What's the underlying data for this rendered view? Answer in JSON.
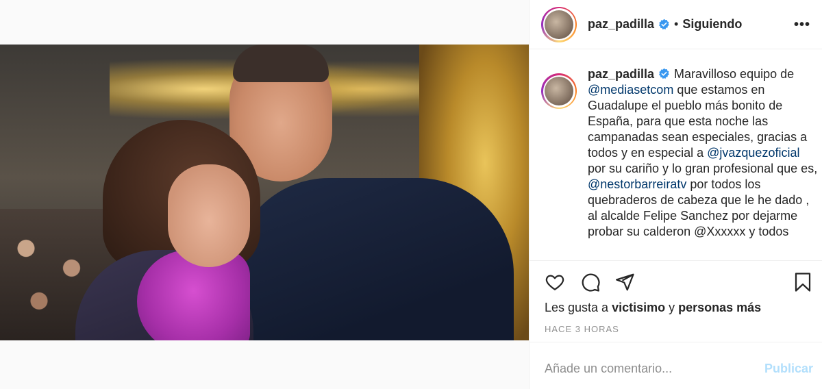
{
  "post": {
    "username": "paz_padilla",
    "follow_status": "Siguiendo",
    "dot": "•",
    "more_label": "•••"
  },
  "caption": {
    "username": "paz_padilla",
    "parts": [
      "Maravilloso equipo de ",
      "@mediasetcom",
      " que estamos en Guadalupe el pueblo más bonito de España, para que esta noche las campanadas sean especiales, gracias a todos y en especial a ",
      "@jvazquezoficial",
      " por su cariño y lo gran profesional que es, ",
      "@nestorbarreiratv",
      " por todos los quebraderos de cabeza que le he dado , al alcalde Felipe Sanchez por dejarme ",
      "probar su calderon @Xxxxxx y todos"
    ]
  },
  "likes": {
    "prefix": "Les gusta a ",
    "user": "victisimo",
    "connector": " y ",
    "others": "personas más"
  },
  "timestamp": "HACE 3 HORAS",
  "comment": {
    "placeholder": "Añade un comentario...",
    "publish_label": "Publicar"
  },
  "colors": {
    "mention": "#00376b",
    "publish": "#b2dffc",
    "verified": "#3897f0"
  },
  "icons": [
    "heart-icon",
    "comment-icon",
    "share-icon",
    "bookmark-icon",
    "verified-icon",
    "more-icon"
  ]
}
